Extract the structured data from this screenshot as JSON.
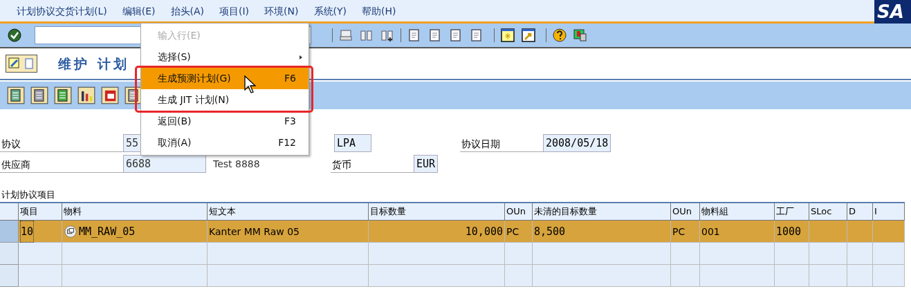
{
  "menubar": {
    "items": [
      "计划协议交货计划(L)",
      "编辑(E)",
      "抬头(A)",
      "项目(I)",
      "环境(N)",
      "系统(Y)",
      "帮助(H)"
    ],
    "logo": "SA"
  },
  "title": "维护 计划",
  "header_fields": [
    {
      "label": "协议",
      "value": "55",
      "value2": "LPA",
      "label2": "协议日期",
      "value3": "2008/05/18"
    },
    {
      "label": "供应商",
      "value": "6688",
      "text": "Test 8888",
      "label2": "货币",
      "value3": "EUR"
    }
  ],
  "items_table": {
    "title": "计划协议项目",
    "columns": [
      "项目",
      "物料",
      "短文本",
      "目标数量",
      "OUn",
      "未清的目标数量",
      "OUn",
      "物料組",
      "工厂",
      "SLoc",
      "D",
      "I"
    ],
    "rows": [
      {
        "selected": true,
        "cells": [
          "10",
          "MM_RAW_05",
          "Kanter MM Raw 05",
          "10,000",
          "PC",
          "8,500",
          "PC",
          "001",
          "1000",
          "",
          "",
          ""
        ]
      },
      {
        "selected": false,
        "cells": [
          "",
          "",
          "",
          "",
          "",
          "",
          "",
          "",
          "",
          "",
          "",
          ""
        ]
      },
      {
        "selected": false,
        "cells": [
          "",
          "",
          "",
          "",
          "",
          "",
          "",
          "",
          "",
          "",
          "",
          ""
        ]
      }
    ]
  },
  "edit_menu": {
    "items": [
      {
        "label": "输入行(E)",
        "disabled": true,
        "selected": false,
        "submenu": false
      },
      {
        "label": "选择(S)",
        "disabled": false,
        "selected": false,
        "submenu": true
      },
      {
        "label": "生成预测计划(G)",
        "shortcut": "F6",
        "disabled": false,
        "selected": true,
        "submenu": false
      },
      {
        "label": "生成 JIT 计划(N)",
        "disabled": false,
        "selected": false,
        "submenu": false
      },
      {
        "label": "返回(B)",
        "shortcut": "F3",
        "disabled": false,
        "selected": false,
        "submenu": false
      },
      {
        "label": "取消(A)",
        "shortcut": "F12",
        "disabled": false,
        "selected": false,
        "submenu": false
      }
    ]
  }
}
